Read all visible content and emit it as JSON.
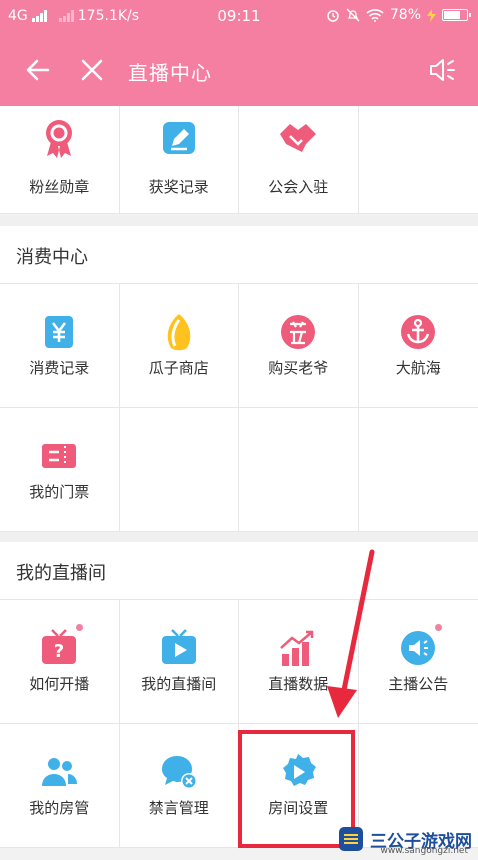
{
  "statusbar": {
    "network": "4G",
    "speed": "175.1K/s",
    "time": "09:11",
    "battery": "78%",
    "battery_level": 0.78
  },
  "header": {
    "title": "直播中心"
  },
  "top_row": {
    "items": [
      {
        "label": "粉丝勋章",
        "icon": "medal-icon"
      },
      {
        "label": "获奖记录",
        "icon": "edit-icon"
      },
      {
        "label": "公会入驻",
        "icon": "handshake-icon"
      }
    ]
  },
  "consumption": {
    "title": "消费中心",
    "items": [
      {
        "label": "消费记录",
        "icon": "yuan-icon"
      },
      {
        "label": "瓜子商店",
        "icon": "seed-icon"
      },
      {
        "label": "购买老爷",
        "icon": "master-icon"
      },
      {
        "label": "大航海",
        "icon": "anchor-icon"
      },
      {
        "label": "我的门票",
        "icon": "ticket-icon"
      }
    ]
  },
  "my_live": {
    "title": "我的直播间",
    "items": [
      {
        "label": "如何开播",
        "icon": "tv-question-icon"
      },
      {
        "label": "我的直播间",
        "icon": "tv-play-icon"
      },
      {
        "label": "直播数据",
        "icon": "bar-chart-icon"
      },
      {
        "label": "主播公告",
        "icon": "announcement-icon"
      },
      {
        "label": "我的房管",
        "icon": "users-icon"
      },
      {
        "label": "禁言管理",
        "icon": "mute-chat-icon"
      },
      {
        "label": "房间设置",
        "icon": "room-settings-icon"
      }
    ]
  },
  "colors": {
    "brand": "#f47fa1",
    "blue": "#3fb0e8",
    "pink": "#ef5b7a",
    "highlight": "#e8283d"
  },
  "watermark": {
    "text": "三公子游戏网",
    "url": "www.sangongzi.net"
  }
}
